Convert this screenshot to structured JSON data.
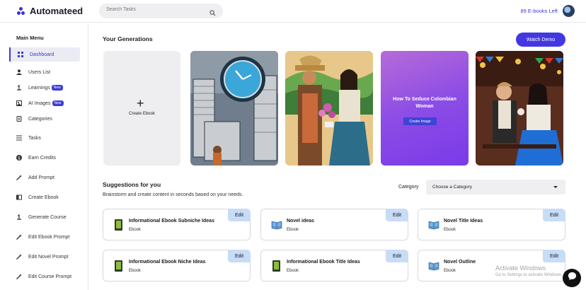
{
  "app": {
    "name": "Automateed",
    "brand_color": "#3b2fd6"
  },
  "header": {
    "search_placeholder": "Search Tasks",
    "credits": "89 E-books Left"
  },
  "sidebar": {
    "title": "Main Menu",
    "items": [
      {
        "label": "Dashboard",
        "icon": "grid-icon",
        "active": true
      },
      {
        "label": "Users List",
        "icon": "user-icon"
      },
      {
        "label": "Learnings",
        "icon": "pin-icon",
        "badge": "New"
      },
      {
        "label": "AI Images",
        "icon": "image-icon",
        "badge": "New"
      },
      {
        "label": "Categories",
        "icon": "document-icon"
      },
      {
        "label": "Tasks",
        "icon": "list-icon"
      },
      {
        "label": "Earn Credits",
        "icon": "dollar-icon"
      },
      {
        "label": "Add Prompt",
        "icon": "magic-wand-icon"
      },
      {
        "label": "Create Ebook",
        "icon": "book-icon"
      },
      {
        "label": "Generate Course",
        "icon": "pin-icon"
      },
      {
        "label": "Edit Ebook Prompt",
        "icon": "magic-wand-icon"
      },
      {
        "label": "Edit Novel Prompt",
        "icon": "magic-wand-icon"
      },
      {
        "label": "Edit Course Prompt",
        "icon": "magic-wand-icon"
      }
    ]
  },
  "generations": {
    "title": "Your Generations",
    "watch_demo": "Watch Demo",
    "create_label": "Create Ebook",
    "promo_title": "How To Seduce Colombian Woman",
    "promo_button": "Create Image"
  },
  "suggestions": {
    "title": "Suggestions for you",
    "subtitle": "Brainstorm and create content in seconds based on your needs.",
    "category_label": "Category",
    "category_value": "Choose a Category",
    "edit_label": "Edit",
    "cards": [
      {
        "title": "Informational Ebook Subniche Ideas",
        "subtitle": "Ebook",
        "icon": "green-book-icon"
      },
      {
        "title": "Novel ideas",
        "subtitle": "Ebook",
        "icon": "open-book-icon"
      },
      {
        "title": "Novel Title Ideas",
        "subtitle": "Ebook",
        "icon": "open-book-icon"
      },
      {
        "title": "Informational Ebook Niche Ideas",
        "subtitle": "Ebook",
        "icon": "green-book-icon"
      },
      {
        "title": "Informational Ebook Title Ideas",
        "subtitle": "Ebook",
        "icon": "green-book-icon"
      },
      {
        "title": "Novel Outline",
        "subtitle": "Ebook",
        "icon": "open-book-icon"
      }
    ]
  },
  "watermark": {
    "line1": "Activate Windows",
    "line2": "Go to Settings to activate Windows."
  }
}
